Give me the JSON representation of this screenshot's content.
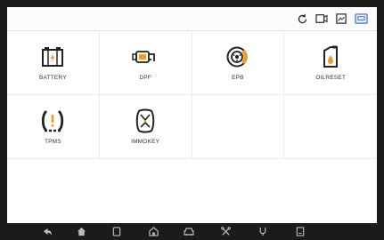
{
  "status_bar": {
    "icons": [
      "refresh-icon",
      "video-record-icon",
      "gallery-icon",
      "vci-icon"
    ]
  },
  "functions": [
    {
      "label": "BATTERY",
      "icon": "battery-icon"
    },
    {
      "label": "DPF",
      "icon": "dpf-icon"
    },
    {
      "label": "EPB",
      "icon": "brake-disc-icon"
    },
    {
      "label": "OILRESET",
      "icon": "oil-can-icon"
    },
    {
      "label": "TPMS",
      "icon": "tpms-icon"
    },
    {
      "label": "IMMOKEY",
      "icon": "car-key-icon"
    }
  ],
  "nav_bar": {
    "buttons": [
      "back-icon",
      "home-icon",
      "recents-icon",
      "house-icon",
      "car-icon",
      "tools-icon",
      "connector-icon",
      "screenshot-icon"
    ]
  },
  "colors": {
    "accent_orange": "#f39c1f",
    "icon_dark": "#222222",
    "nav_background": "#1b1b1b"
  }
}
